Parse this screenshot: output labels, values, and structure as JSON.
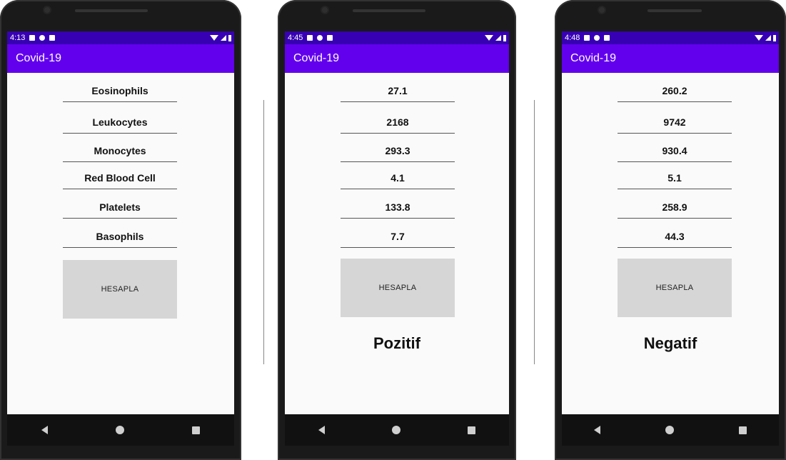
{
  "app_title": "Covid-19",
  "button_label": "HESAPLA",
  "phones": [
    {
      "time": "4:13",
      "fields": [
        "Eosinophils",
        "Leukocytes",
        "Monocytes",
        "Red Blood Cell",
        "Platelets",
        "Basophils"
      ],
      "result": ""
    },
    {
      "time": "4:45",
      "fields": [
        "27.1",
        "2168",
        "293.3",
        "4.1",
        "133.8",
        "7.7"
      ],
      "result": "Pozitif"
    },
    {
      "time": "4:48",
      "fields": [
        "260.2",
        "9742",
        "930.4",
        "5.1",
        "258.9",
        "44.3"
      ],
      "result": "Negatif"
    }
  ]
}
